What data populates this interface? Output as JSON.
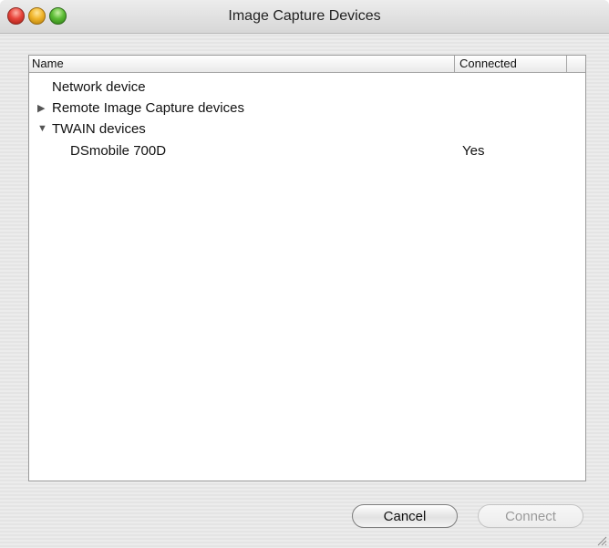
{
  "window": {
    "title": "Image Capture Devices"
  },
  "table": {
    "columns": [
      "Name",
      "Connected"
    ],
    "rows": [
      {
        "label": "Network device",
        "connected": "",
        "indent": 0,
        "disclosure": ""
      },
      {
        "label": "Remote Image Capture devices",
        "connected": "",
        "indent": 0,
        "disclosure": "▶"
      },
      {
        "label": "TWAIN devices",
        "connected": "",
        "indent": 0,
        "disclosure": "▼"
      },
      {
        "label": "DSmobile 700D",
        "connected": "Yes",
        "indent": 1,
        "disclosure": ""
      }
    ]
  },
  "buttons": {
    "cancel": "Cancel",
    "connect": "Connect"
  },
  "icons": {
    "close": "close-icon",
    "minimize": "minimize-icon",
    "zoom": "zoom-icon",
    "collapsed": "disclosure-collapsed-icon",
    "expanded": "disclosure-expanded-icon",
    "resize": "resize-grip-icon"
  }
}
